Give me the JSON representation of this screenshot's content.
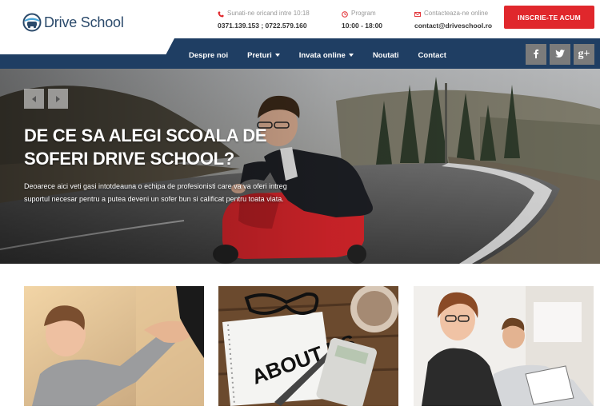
{
  "brand": {
    "name": "Drive School"
  },
  "contact": {
    "phone_label": "Sunati-ne oricand intre 10:18",
    "phone_value": "0371.139.153 ; 0722.579.160",
    "schedule_label": "Program",
    "schedule_value": "10:00 - 18:00",
    "email_label": "Contacteaza-ne online",
    "email_value": "contact@driveschool.ro"
  },
  "cta": {
    "label": "INSCRIE-TE ACUM"
  },
  "nav": {
    "items": [
      {
        "label": "Despre noi",
        "dropdown": false
      },
      {
        "label": "Preturi",
        "dropdown": true
      },
      {
        "label": "Invata online",
        "dropdown": true
      },
      {
        "label": "Noutati",
        "dropdown": false
      },
      {
        "label": "Contact",
        "dropdown": false
      }
    ]
  },
  "social": {
    "facebook": "f",
    "twitter": "t",
    "google": "g+"
  },
  "hero": {
    "title": "DE CE SA ALEGI SCOALA DE SOFERI DRIVE SCHOOL?",
    "text": "Deoarece aici veti gasi intotdeauna o echipa de profesionisti care va va oferi intreg suportul necesar pentru a putea deveni un sofer bun si calificat pentru toata viata."
  },
  "cards": {
    "card2_note": "ABOUT US"
  },
  "colors": {
    "navy": "#1f3e63",
    "accent": "#e0272c",
    "social": "#7b7b7b"
  },
  "icons": [
    "phone-icon",
    "clock-icon",
    "mail-icon",
    "facebook-icon",
    "twitter-icon",
    "google-plus-icon",
    "arrow-left-icon",
    "arrow-right-icon",
    "chevron-down-icon"
  ]
}
